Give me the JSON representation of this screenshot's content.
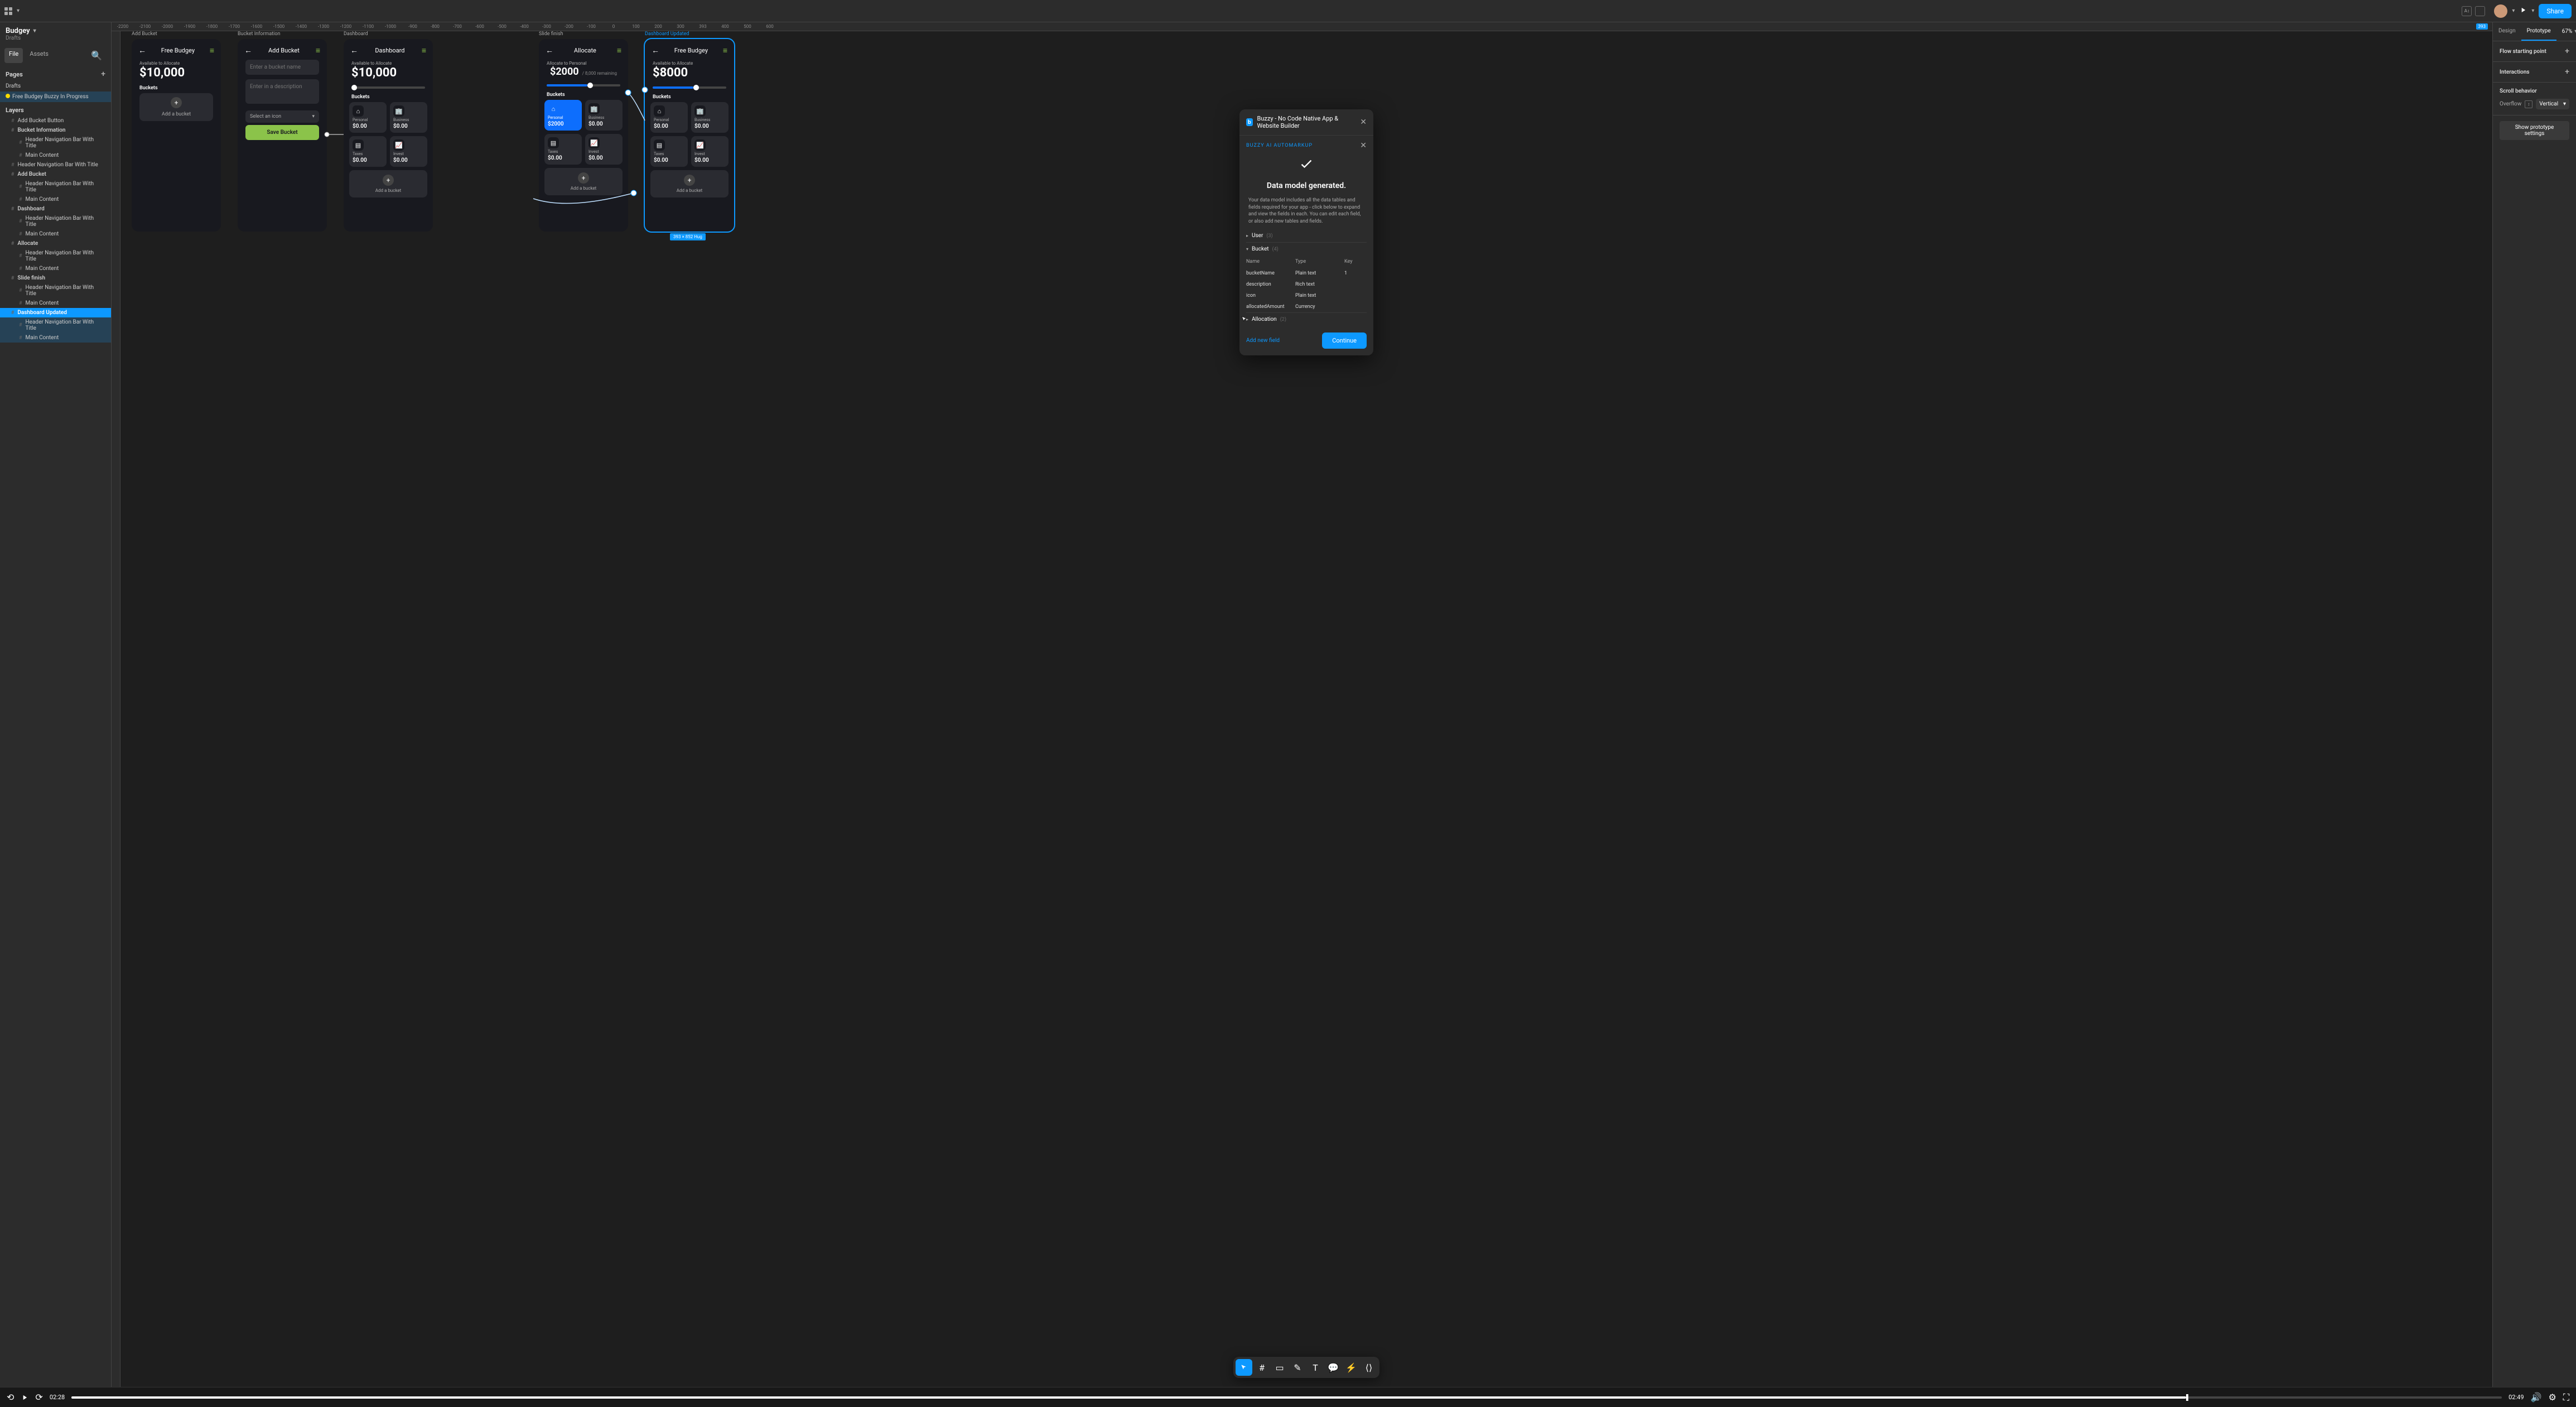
{
  "topbar": {
    "avatarPresent": true,
    "shareLabel": "Share"
  },
  "leftPanel": {
    "title": "Budgey",
    "subtitle": "Drafts",
    "tabs": {
      "file": "File",
      "assets": "Assets"
    },
    "pagesHeader": "Pages",
    "draftsLabel": "Drafts",
    "pageName": "Free Budgey Buzzy In Progress",
    "layersHeader": "Layers",
    "layers": [
      {
        "t": "Add Bucket Button",
        "l": 1
      },
      {
        "t": "Bucket Information",
        "l": 1,
        "bold": true
      },
      {
        "t": "Header Navigation Bar With Title",
        "l": 2
      },
      {
        "t": "Main Content",
        "l": 2
      },
      {
        "t": "Header Navigation Bar With Title",
        "l": 1
      },
      {
        "t": "Add Bucket",
        "l": 1,
        "bold": true
      },
      {
        "t": "Header Navigation Bar With Title",
        "l": 2
      },
      {
        "t": "Main Content",
        "l": 2
      },
      {
        "t": "Dashboard",
        "l": 1,
        "bold": true
      },
      {
        "t": "Header Navigation Bar With Title",
        "l": 2
      },
      {
        "t": "Main Content",
        "l": 2
      },
      {
        "t": "Allocate",
        "l": 1,
        "bold": true
      },
      {
        "t": "Header Navigation Bar With Title",
        "l": 2
      },
      {
        "t": "Main Content",
        "l": 2
      },
      {
        "t": "Slide finish",
        "l": 1,
        "bold": true
      },
      {
        "t": "Header Navigation Bar With Title",
        "l": 2
      },
      {
        "t": "Main Content",
        "l": 2
      },
      {
        "t": "Dashboard Updated",
        "l": 1,
        "bold": true,
        "sel": true
      },
      {
        "t": "Header Navigation Bar With Title",
        "l": 2,
        "hov": true
      },
      {
        "t": "Main Content",
        "l": 2,
        "hov": true
      }
    ]
  },
  "ruler": {
    "marks": [
      "-2200",
      "-2100",
      "-2000",
      "-1900",
      "-1800",
      "-1700",
      "-1600",
      "-1500",
      "-1400",
      "-1300",
      "-1200",
      "-1100",
      "-1000",
      "-900",
      "-800",
      "-700",
      "-600",
      "-500",
      "-400",
      "-300",
      "-200",
      "-100",
      "0",
      "100",
      "200",
      "300",
      "393",
      "400",
      "500",
      "600"
    ],
    "selWidth": "393"
  },
  "frames": {
    "addBucket": {
      "label": "Add Bucket",
      "title": "Free Budgey",
      "availLabel": "Available to Allocate",
      "amount": "$10,000",
      "bucketsLabel": "Buckets",
      "addBucketText": "Add a bucket"
    },
    "bucketInfo": {
      "label": "Bucket Information",
      "title": "Add Bucket",
      "namePlaceholder": "Enter a bucket name",
      "descPlaceholder": "Enter in a description",
      "iconPlaceholder": "Select an icon",
      "saveLabel": "Save Bucket"
    },
    "dashboard": {
      "label": "Dashboard",
      "title": "Dashboard",
      "availLabel": "Available to Allocate",
      "amount": "$10,000",
      "bucketsLabel": "Buckets",
      "cells": [
        {
          "lab": "Personal",
          "val": "$0.00"
        },
        {
          "lab": "Business",
          "val": "$0.00"
        },
        {
          "lab": "Taxes",
          "val": "$0.00"
        },
        {
          "lab": "Invest",
          "val": "$0.00"
        }
      ],
      "addBucketText": "Add a bucket"
    },
    "slideFinish": {
      "label": "Slide finish"
    },
    "allocate": {
      "title": "Allocate",
      "availLabel": "Allocate to Personal",
      "amount": "$2000",
      "remaining": "/ 8,000 remaining",
      "bucketsLabel": "Buckets",
      "cells": [
        {
          "lab": "Personal",
          "val": "$2000",
          "active": true
        },
        {
          "lab": "Business",
          "val": "$0.00"
        },
        {
          "lab": "Taxes",
          "val": "$0.00"
        },
        {
          "lab": "Invest",
          "val": "$0.00"
        }
      ],
      "addBucketText": "Add a bucket"
    },
    "dashUpdated": {
      "label": "Dashboard Updated",
      "title": "Free Budgey",
      "availLabel": "Available to Allocate",
      "amount": "$8000",
      "bucketsLabel": "Buckets",
      "cells": [
        {
          "lab": "Personal",
          "val": "$0.00"
        },
        {
          "lab": "Business",
          "val": "$0.00"
        },
        {
          "lab": "Taxes",
          "val": "$0.00"
        },
        {
          "lab": "Invest",
          "val": "$0.00"
        }
      ],
      "addBucketText": "Add a bucket",
      "sizeChip": "393 × 852  Hug"
    }
  },
  "modal": {
    "title": "Buzzy - No Code Native App & Website Builder",
    "subtitle": "BUZZY AI AUTOMARKUP",
    "heading": "Data model generated.",
    "desc": "Your data model includes all the data tables and fields required for your app - click below to expand and view the fields in each. You can edit each field, or also add new tables and fields.",
    "tree": [
      {
        "name": "User",
        "count": "(3)",
        "chev": "▸"
      },
      {
        "name": "Bucket",
        "count": "(4)",
        "chev": "▾",
        "open": true
      }
    ],
    "thead": {
      "name": "Name",
      "type": "Type",
      "key": "Key"
    },
    "fields": [
      {
        "name": "bucketName",
        "type": "Plain text",
        "key": "1"
      },
      {
        "name": "description",
        "type": "Rich text",
        "key": ""
      },
      {
        "name": "icon",
        "type": "Plain text",
        "key": ""
      },
      {
        "name": "allocatedAmount",
        "type": "Currency",
        "key": ""
      }
    ],
    "allocation": {
      "name": "Allocation",
      "count": "(2)",
      "chev": "▸"
    },
    "addField": "Add new field",
    "continueLabel": "Continue"
  },
  "rightPanel": {
    "tabs": {
      "design": "Design",
      "prototype": "Prototype"
    },
    "zoom": "67%",
    "flowHeader": "Flow starting point",
    "interactionsHeader": "Interactions",
    "scrollHeader": "Scroll behavior",
    "overflowLabel": "Overflow",
    "overflowValue": "Vertical",
    "showProtoBtn": "Show prototype settings"
  },
  "playbar": {
    "current": "02:28",
    "total": "02:49",
    "progressPct": 87
  }
}
